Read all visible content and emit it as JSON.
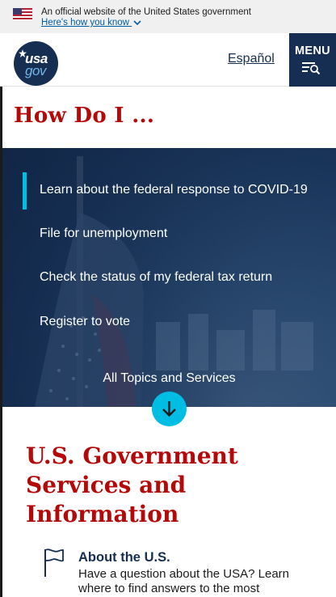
{
  "banner": {
    "text": "An official website of the United States government",
    "link": "Here's how you know",
    "flag_icon": "us-flag-icon"
  },
  "header": {
    "logo_top": "usa",
    "logo_bottom": "gov",
    "language_link": "Español",
    "menu_label": "MENU"
  },
  "how_do_i": {
    "title": "How Do I ...",
    "links": [
      "Learn about the federal response to COVID-19",
      "File for unemployment",
      "Check the status of my federal tax return",
      "Register to vote"
    ],
    "all_topics": "All Topics and Services"
  },
  "services": {
    "title": "U.S. Government Services and Information",
    "items": [
      {
        "title": "About the U.S.",
        "description": "Have a question about the USA? Learn where to find answers to the most",
        "icon": "flag-icon"
      }
    ]
  },
  "colors": {
    "navy": "#162e51",
    "red": "#b50909",
    "cyan": "#00bde3",
    "link_blue": "#005ea2"
  }
}
